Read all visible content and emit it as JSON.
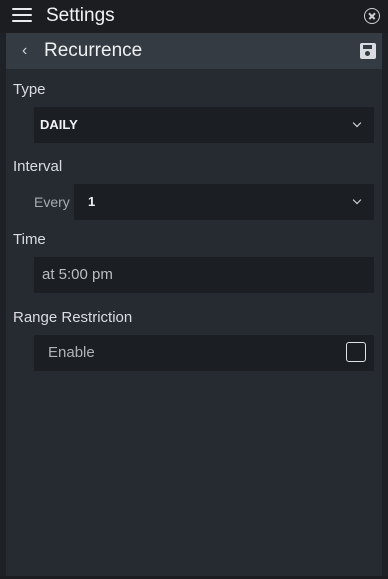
{
  "topbar": {
    "title": "Settings",
    "menu_icon": "hamburger-menu-icon",
    "close_icon": "circle-close-icon"
  },
  "subheader": {
    "title": "Recurrence",
    "back_icon": "chevron-left-icon",
    "save_icon": "floppy-disk-icon"
  },
  "type_section": {
    "label": "Type",
    "selected": "DAILY"
  },
  "interval_section": {
    "label": "Interval",
    "prefix": "Every",
    "selected": "1"
  },
  "time_section": {
    "label": "Time",
    "value": "at 5:00 pm"
  },
  "range_section": {
    "label": "Range Restriction",
    "enable_label": "Enable",
    "enabled": false
  },
  "colors": {
    "background": "#1e2226",
    "panel": "#262b31",
    "subheader": "#343b42",
    "field": "#1b1f24"
  }
}
